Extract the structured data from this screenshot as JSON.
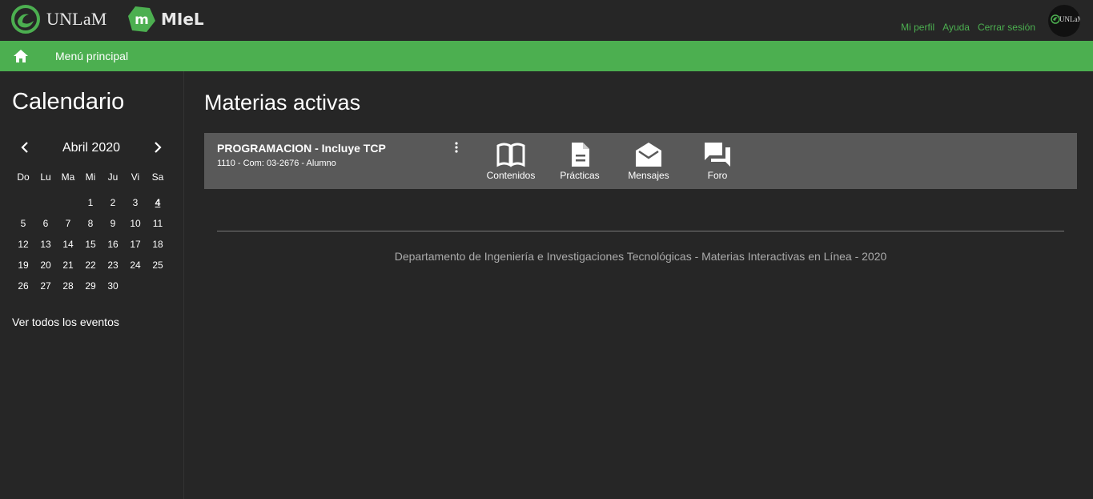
{
  "header": {
    "unlam_logo_text": "UNLaM",
    "miel_logo_text": "MIeL",
    "miel_badge_letter": "m",
    "links": [
      "Mi perfil",
      "Ayuda",
      "Cerrar sesión"
    ],
    "avatar_text": "UNLaM",
    "accent_color": "#4caf50"
  },
  "navbar": {
    "home_icon": "home-icon",
    "label": "Menú principal"
  },
  "sidebar": {
    "title": "Calendario",
    "month_label": "Abril 2020",
    "weekdays": [
      "Do",
      "Lu",
      "Ma",
      "Mi",
      "Ju",
      "Vi",
      "Sa"
    ],
    "weeks": [
      [
        "",
        "",
        "",
        "1",
        "2",
        "3",
        "4"
      ],
      [
        "5",
        "6",
        "7",
        "8",
        "9",
        "10",
        "11"
      ],
      [
        "12",
        "13",
        "14",
        "15",
        "16",
        "17",
        "18"
      ],
      [
        "19",
        "20",
        "21",
        "22",
        "23",
        "24",
        "25"
      ],
      [
        "26",
        "27",
        "28",
        "29",
        "30",
        "",
        ""
      ]
    ],
    "today": "4",
    "events_link": "Ver todos los eventos"
  },
  "main": {
    "title": "Materias activas",
    "courses": [
      {
        "name": "PROGRAMACION - Incluye TCP",
        "meta": "1110 - Com: 03-2676 - Alumno",
        "actions": [
          {
            "label": "Contenidos",
            "icon": "book-icon"
          },
          {
            "label": "Prácticas",
            "icon": "document-icon"
          },
          {
            "label": "Mensajes",
            "icon": "mail-open-icon"
          },
          {
            "label": "Foro",
            "icon": "forum-icon"
          }
        ]
      }
    ]
  },
  "footer": {
    "text": "Departamento de Ingeniería e Investigaciones Tecnológicas - Materias Interactivas en Línea - 2020"
  }
}
